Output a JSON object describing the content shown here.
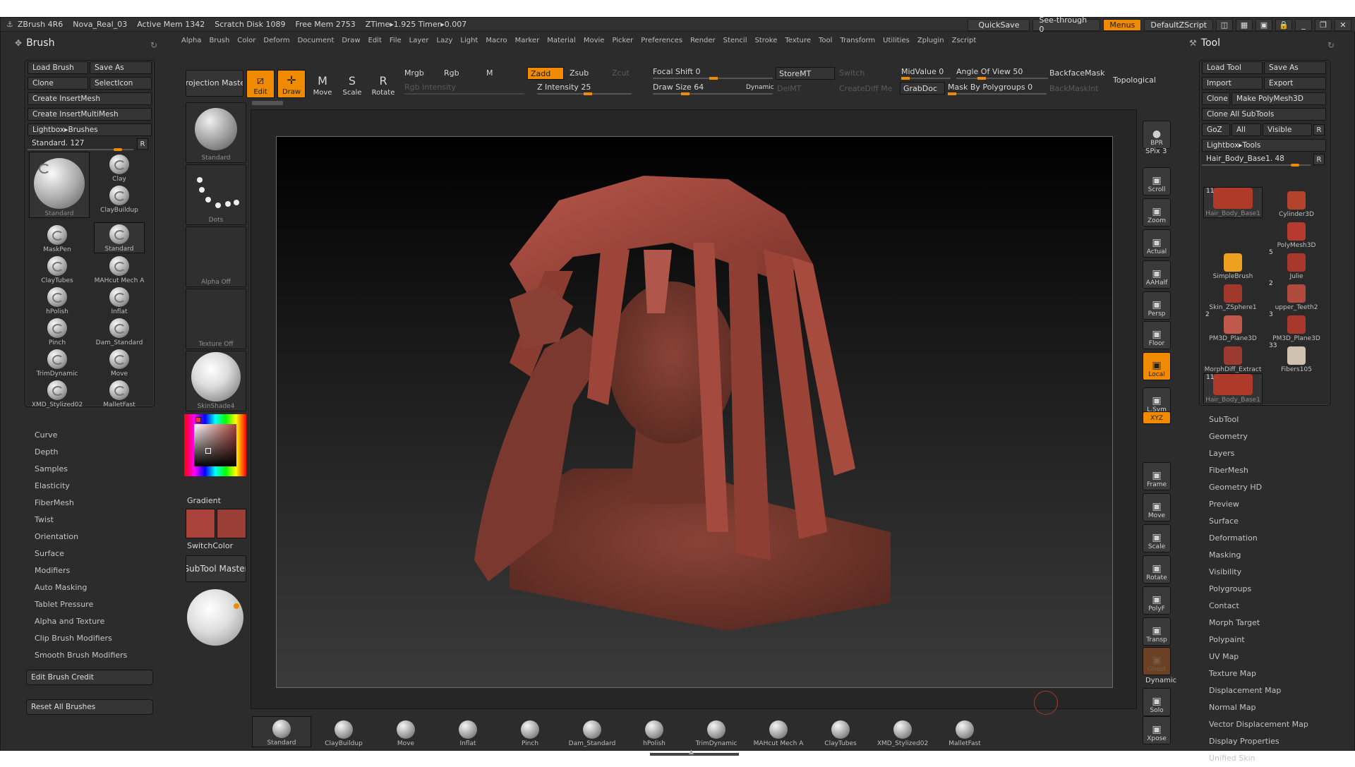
{
  "titlebar": {
    "app": "ZBrush 4R6",
    "document": "Nova_Real_03",
    "active_mem": "Active Mem 1342",
    "scratch_disk": "Scratch Disk 1089",
    "free_mem": "Free Mem 2753",
    "ztime": "ZTime▸1.925 Timer▸0.007",
    "quicksave": "QuickSave",
    "see_through": "See-through  0",
    "menus": "Menus",
    "default_zscript": "DefaultZScript"
  },
  "menubar": [
    "Alpha",
    "Brush",
    "Color",
    "Deform",
    "Document",
    "Draw",
    "Edit",
    "File",
    "Layer",
    "Lazy",
    "Light",
    "Macro",
    "Marker",
    "Material",
    "Movie",
    "Picker",
    "Preferences",
    "Render",
    "Stencil",
    "Stroke",
    "Texture",
    "Tool",
    "Transform",
    "Utilities",
    "Zplugin",
    "Zscript"
  ],
  "brush_panel": {
    "title": "Brush",
    "load_brush": "Load Brush",
    "save_as": "Save As",
    "clone": "Clone",
    "select_icon": "SelectIcon",
    "create_insertmesh": "Create InsertMesh",
    "create_insertmultimesh": "Create InsertMultiMesh",
    "lightbox_brushes": "Lightbox▸Brushes",
    "current": "Standard. 127",
    "r": "R",
    "large_name": "Standard",
    "brushes": [
      "Clay",
      "ClayBuildup",
      "MaskPen",
      "Standard",
      "ClayTubes",
      "MAHcut Mech A",
      "hPolish",
      "Inflat",
      "Pinch",
      "Dam_Standard",
      "TrimDynamic",
      "Move",
      "XMD_Stylized02",
      "MalletFast"
    ],
    "submenus": [
      "Curve",
      "Depth",
      "Samples",
      "Elasticity",
      "FiberMesh",
      "Twist",
      "Orientation",
      "Surface",
      "Modifiers",
      "Auto Masking",
      "Tablet Pressure",
      "Alpha and Texture",
      "Clip Brush Modifiers",
      "Smooth Brush Modifiers"
    ],
    "edit_brush_credit": "Edit Brush Credit",
    "reset_all_brushes": "Reset All Brushes"
  },
  "left_shelf": {
    "standard": "Standard",
    "dots": "Dots",
    "alpha_off": "Alpha  Off",
    "texture_off": "Texture  Off",
    "material": "SkinShade4",
    "gradient": "Gradient",
    "switchcolor": "SwitchColor",
    "subtool_master": "SubTool Master",
    "main_color": "#a9423a",
    "secondary_color": "#9a3e36"
  },
  "top_shelf": {
    "projection_master": "Projection Master",
    "edit": "Edit",
    "draw": "Draw",
    "move": "Move",
    "scale": "Scale",
    "rotate": "Rotate",
    "mrgb": "Mrgb",
    "rgb": "Rgb",
    "m": "M",
    "rgb_intensity": "Rgb  Intensity",
    "zadd": "Zadd",
    "zsub": "Zsub",
    "zcut": "Zcut",
    "z_intensity": "Z Intensity 25",
    "focal_shift": "Focal Shift 0",
    "draw_size": "Draw  Size 64",
    "dynamic": "Dynamic",
    "storemt": "StoreMT",
    "delmt": "DelMT",
    "switch": "Switch",
    "creatediff": "CreateDiff Me",
    "midvalue": "MidValue 0",
    "grabdoc": "GrabDoc",
    "angle_of_view": "Angle  Of  View 50",
    "mask_by_polygroups": "Mask By Polygroups 0",
    "backfacemask": "BackfaceMask",
    "backmaskint": "BackMaskInt",
    "topological": "Topological"
  },
  "right_nav": [
    {
      "label": "BPR",
      "icon": "bpr-sphere-icon"
    },
    {
      "label": "SPix 3",
      "icon": ""
    },
    {
      "label": "Scroll",
      "icon": "hand-icon"
    },
    {
      "label": "Zoom",
      "icon": "zoom-icon"
    },
    {
      "label": "Actual",
      "icon": "actual-icon"
    },
    {
      "label": "AAHalf",
      "icon": "aahalf-icon"
    },
    {
      "label": "Persp",
      "icon": "persp-icon"
    },
    {
      "label": "Floor",
      "icon": "floor-icon"
    },
    {
      "label": "Local",
      "icon": "local-icon"
    },
    {
      "label": "L.Sym",
      "icon": "lsym-icon"
    },
    {
      "label": "XYZ",
      "icon": "xyz-icon"
    },
    {
      "label": "Frame",
      "icon": "frame-icon"
    },
    {
      "label": "Move",
      "icon": "move-icon"
    },
    {
      "label": "Scale",
      "icon": "scale-icon"
    },
    {
      "label": "Rotate",
      "icon": "rotate-icon"
    },
    {
      "label": "PolyF",
      "icon": "polyf-icon"
    },
    {
      "label": "Transp",
      "icon": "transp-icon"
    },
    {
      "label": "Ghost",
      "icon": "ghost-icon"
    },
    {
      "label": "Dynamic",
      "icon": ""
    },
    {
      "label": "Solo",
      "icon": "solo-icon"
    },
    {
      "label": "Xpose",
      "icon": "xpose-icon"
    }
  ],
  "tool_panel": {
    "title": "Tool",
    "load_tool": "Load Tool",
    "save_as": "Save As",
    "import": "Import",
    "export": "Export",
    "clone": "Clone",
    "make_polymesh3d": "Make PolyMesh3D",
    "clone_all_subtools": "Clone All SubTools",
    "goz": "GoZ",
    "all": "All",
    "visible": "Visible",
    "r": "R",
    "lightbox_tools": "Lightbox▸Tools",
    "current": "Hair_Body_Base1. 48",
    "tools": [
      {
        "name": "Hair_Body_Base1",
        "count": "11"
      },
      {
        "name": "Cylinder3D",
        "count": ""
      },
      {
        "name": "PolyMesh3D",
        "count": ""
      },
      {
        "name": "SimpleBrush",
        "count": ""
      },
      {
        "name": "Julie",
        "count": "5"
      },
      {
        "name": "Skin_ZSphere1",
        "count": ""
      },
      {
        "name": "upper_Teeth2",
        "count": "2"
      },
      {
        "name": "PM3D_Plane3D",
        "count": "2"
      },
      {
        "name": "PM3D_Plane3D",
        "count": "3"
      },
      {
        "name": "MorphDiff_Extract",
        "count": ""
      },
      {
        "name": "Fibers105",
        "count": "33"
      },
      {
        "name": "Hair_Body_Base1",
        "count": "11"
      }
    ],
    "submenus": [
      "SubTool",
      "Geometry",
      "Layers",
      "FiberMesh",
      "Geometry HD",
      "Preview",
      "Surface",
      "Deformation",
      "Masking",
      "Visibility",
      "Polygroups",
      "Contact",
      "Morph Target",
      "Polypaint",
      "UV Map",
      "Texture Map",
      "Displacement Map",
      "Normal Map",
      "Vector Displacement Map",
      "Display Properties",
      "Unified Skin"
    ]
  },
  "bottom_shelf": [
    "Standard",
    "ClayBuildup",
    "Move",
    "Inflat",
    "Pinch",
    "Dam_Standard",
    "hPolish",
    "TrimDynamic",
    "MAHcut Mech A",
    "ClayTubes",
    "XMD_Stylized02",
    "MalletFast"
  ],
  "colors": {
    "accent": "#f08a00",
    "bg": "#2c2c2c",
    "model": "#9a4a3e"
  }
}
